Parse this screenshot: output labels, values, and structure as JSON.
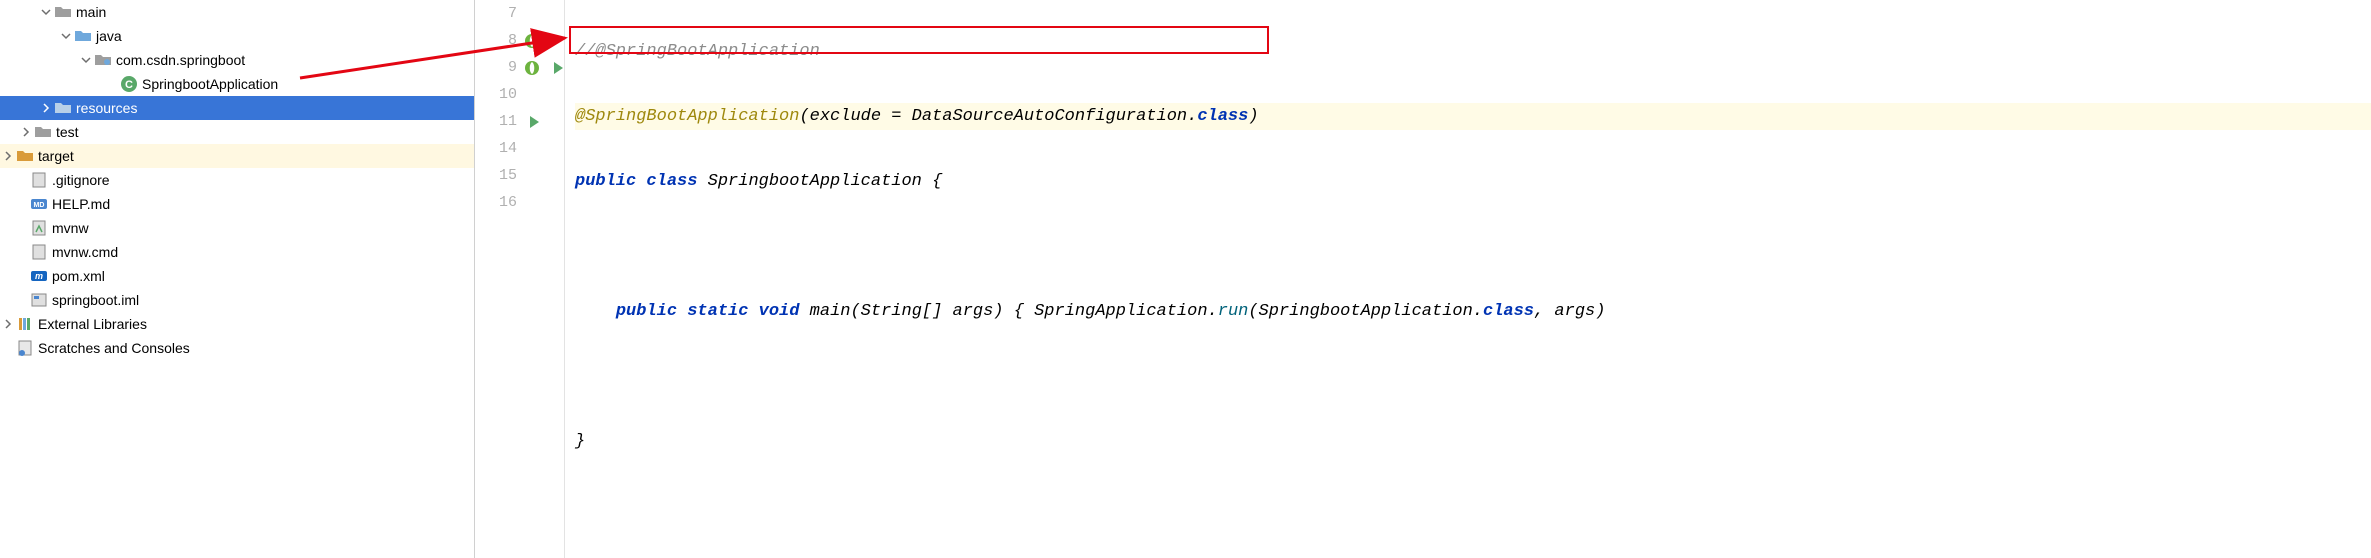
{
  "tree": {
    "main": "main",
    "java": "java",
    "pkg": "com.csdn.springboot",
    "app_class": "SpringbootApplication",
    "resources": "resources",
    "test": "test",
    "target": "target",
    "gitignore": ".gitignore",
    "help": "HELP.md",
    "mvnw": "mvnw",
    "mvnwcmd": "mvnw.cmd",
    "pom": "pom.xml",
    "iml": "springboot.iml",
    "ext_libs": "External Libraries",
    "scratches": "Scratches and Consoles"
  },
  "editor": {
    "lines": {
      "l7": "7",
      "l8": "8",
      "l9": "9",
      "l10": "10",
      "l11": "11",
      "l14": "14",
      "l15": "15",
      "l16": "16"
    },
    "code": {
      "c7_comment": "//@SpringBootApplication",
      "c8_anno": "@SpringBootApplication",
      "c8_open": "(",
      "c8_arg": "exclude = DataSourceAutoConfiguration.",
      "c8_kw": "class",
      "c8_close": ")",
      "c9_kw1": "public",
      "c9_kw2": "class",
      "c9_name": "SpringbootApplication {",
      "c11_kw1": "public",
      "c11_kw2": "static",
      "c11_kw3": "void",
      "c11_name": "main(String[] args) { SpringApplication.",
      "c11_run": "run",
      "c11_tail": "(SpringbootApplication.",
      "c11_kw4": "class",
      "c11_end": ", args)",
      "c15_brace": "}"
    }
  }
}
